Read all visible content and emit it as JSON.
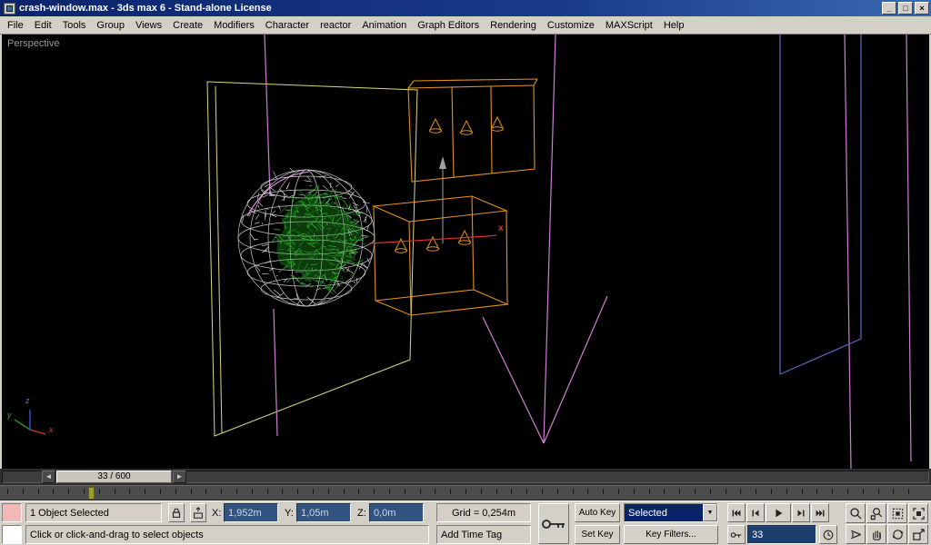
{
  "window": {
    "title": "crash-window.max - 3ds max 6 - Stand-alone License",
    "controls": {
      "minimize": "_",
      "restore": "□",
      "close": "×"
    }
  },
  "menu": {
    "items": [
      "File",
      "Edit",
      "Tools",
      "Group",
      "Views",
      "Create",
      "Modifiers",
      "Character",
      "reactor",
      "Animation",
      "Graph Editors",
      "Rendering",
      "Customize",
      "MAXScript",
      "Help"
    ]
  },
  "viewport": {
    "label": "Perspective",
    "axis_labels": {
      "x": "x",
      "y": "y",
      "z": "z"
    },
    "gizmo_x_label": "x",
    "wire_colors": {
      "plane": "#d8d884",
      "boxes": "#e2921e",
      "spline": "#cf7fd4",
      "mesh_green": "#22aa22",
      "sphere": "#dcdcdc",
      "shape_blue": "#5a6ac0",
      "gizmo_red": "#dd3333"
    }
  },
  "time_slider": {
    "value": "33 / 600",
    "prev_arrow": "◄",
    "next_arrow": "►"
  },
  "track_bar": {
    "current_frame": 33,
    "total_frames": 600
  },
  "status_bar": {
    "selection_status": "1 Object Selected",
    "prompt": "Click or click-and-drag to select objects",
    "coordinates": {
      "x_label": "X:",
      "x_value": "1,952m",
      "y_label": "Y:",
      "y_value": "1,05m",
      "z_label": "Z:",
      "z_value": "0,0m"
    },
    "grid_size": "Grid = 0,254m",
    "time_tag": "Add Time Tag"
  },
  "animation_controls": {
    "auto_key": "Auto Key",
    "set_key": "Set Key",
    "selection_set": "Selected",
    "key_filters": "Key Filters...",
    "current_frame": "33",
    "combo_arrow": "▼"
  }
}
